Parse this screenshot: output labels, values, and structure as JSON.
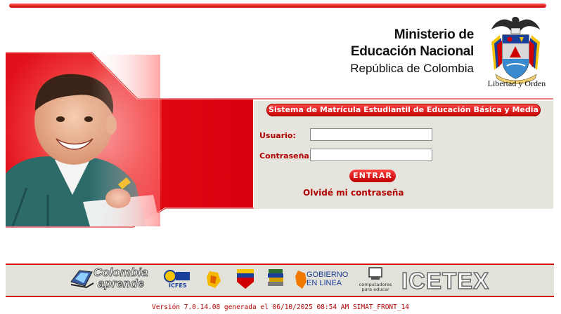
{
  "header": {
    "ministry_line1": "Ministerio de",
    "ministry_line2": "Educación Nacional",
    "ministry_line3": "República de Colombia",
    "motto": "Libertad y Orden",
    "shield_icon": "colombia-coat-of-arms-icon"
  },
  "login": {
    "system_title": "Sistema de Matrícula Estudiantil de Educación Básica y Media",
    "user_label": "Usuario:",
    "user_value": "",
    "password_label": "Contraseña:",
    "password_value": "",
    "submit_label": "ENTRAR",
    "forgot_label": "Olvidé mi contraseña"
  },
  "footer": {
    "logos": [
      {
        "name": "colombia-aprende",
        "text_line1": "Colombia",
        "text_line2": "aprende"
      },
      {
        "name": "icfes",
        "text": "ICFES"
      },
      {
        "name": "colombia-aprende-small"
      },
      {
        "name": "ministerio-small"
      },
      {
        "name": "catalogo"
      },
      {
        "name": "gobierno-en-linea",
        "text_line1": "GOBIERNO",
        "text_line2": "EN LINEA"
      },
      {
        "name": "computadores-para-educar",
        "text_line1": "computadores",
        "text_line2": "para educar"
      },
      {
        "name": "icetex",
        "text": "ICETEX"
      }
    ],
    "version": "Versión 7.0.14.08 generada el 06/10/2025 08:54 AM SIMAT_FRONT_14"
  },
  "colors": {
    "accent": "#d40000",
    "panel": "#e6e5dd",
    "footer_panel": "#e3e2da"
  }
}
